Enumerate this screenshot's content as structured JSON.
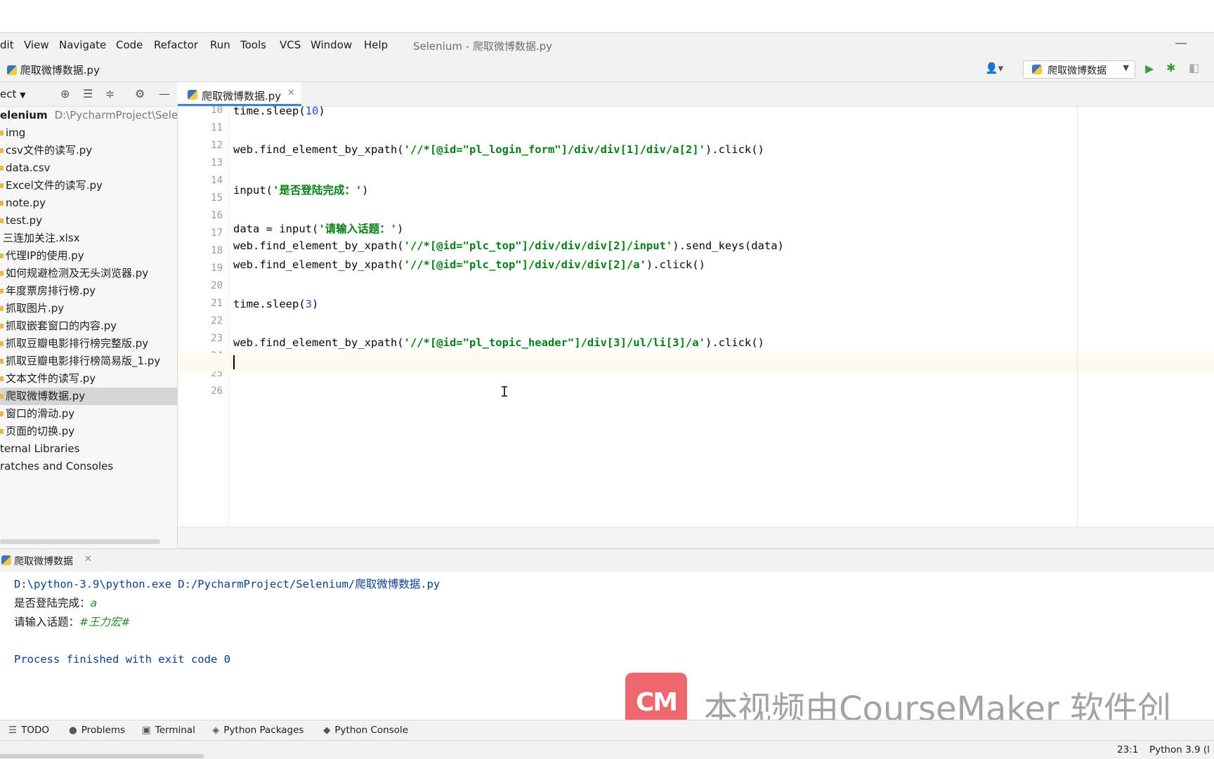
{
  "menubar": {
    "items": [
      "dit",
      "View",
      "Navigate",
      "Code",
      "Refactor",
      "Run",
      "Tools",
      "VCS",
      "Window",
      "Help"
    ],
    "title": "Selenium - 爬取微博数据.py",
    "minimize": "—"
  },
  "navbar": {
    "breadcrumb": "爬取微博数据.py",
    "run_config": "爬取微博数据",
    "icons": [
      "user-icon",
      "run-icon",
      "debug-icon",
      "coverage-icon"
    ]
  },
  "project": {
    "header_label": "ect",
    "root_name": "elenium",
    "root_path": "D:\\PycharmProject\\Seleniu",
    "items": [
      "img",
      "csv文件的读写.py",
      "data.csv",
      "Excel文件的读写.py",
      "note.py",
      "test.py",
      "三连加关注.xlsx",
      "代理IP的使用.py",
      "如何规避检测及无头浏览器.py",
      "年度票房排行榜.py",
      "抓取图片.py",
      "抓取嵌套窗口的内容.py",
      "抓取豆瓣电影排行榜完整版.py",
      "抓取豆瓣电影排行榜简易版_1.py",
      "文本文件的读写.py",
      "爬取微博数据.py",
      "窗口的滑动.py",
      "页面的切换.py"
    ],
    "selected": "爬取微博数据.py",
    "external": "ternal Libraries",
    "scratches": "ratches and Consoles"
  },
  "editor": {
    "tab_label": "爬取微博数据.py",
    "line_numbers": [
      "10",
      "11",
      "12",
      "13",
      "14",
      "15",
      "16",
      "17",
      "18",
      "19",
      "20",
      "21",
      "22",
      "23",
      "24",
      "25",
      "26"
    ],
    "current_line": "23",
    "lines": {
      "l10_a": "time.sleep(",
      "l10_n": "10",
      "l10_b": ")",
      "l12_a": "web.find_element_by_xpath(",
      "l12_s": "'//*[@id=\"pl_login_form\"]/div/div[1]/div/a[2]'",
      "l12_b": ").click()",
      "l14_a": "input(",
      "l14_s": "'是否登陆完成：'",
      "l14_b": ")",
      "l16_a": "data = input(",
      "l16_s": "'请输入话题：'",
      "l16_b": ")",
      "l17_a": "web.find_element_by_xpath(",
      "l17_s": "'//*[@id=\"plc_top\"]/div/div/div[2]/input'",
      "l17_b": ").send_keys(data)",
      "l18_a": "web.find_element_by_xpath(",
      "l18_s": "'//*[@id=\"plc_top\"]/div/div/div[2]/a'",
      "l18_b": ").click()",
      "l20_a": "time.sleep(",
      "l20_n": "3",
      "l20_b": ")",
      "l22_a": "web.find_element_by_xpath(",
      "l22_s": "'//*[@id=\"pl_topic_header\"]/div[3]/ul/li[3]/a'",
      "l22_b": ").click()"
    },
    "cursor_glyph": "I"
  },
  "run_panel": {
    "tab_label": "爬取微博数据",
    "command": "D:\\python-3.9\\python.exe D:/PycharmProject/Selenium/爬取微博数据.py",
    "prompt1": "是否登陆完成：",
    "input1": "a",
    "prompt2": "请输入话题：",
    "input2": "#王力宏#",
    "finished": "Process finished with exit code 0"
  },
  "watermark": {
    "logo": "CM",
    "text": "本视频由CourseMaker 软件创"
  },
  "toolwindows": [
    "TODO",
    "Problems",
    "Terminal",
    "Python Packages",
    "Python Console"
  ],
  "statusbar": {
    "position": "23:1",
    "interpreter": "Python 3.9 (l"
  },
  "colors": {
    "string": "#067d17",
    "number": "#1750eb",
    "console_path": "#0b3f8c",
    "user_input": "#2a8a2a",
    "tab_accent": "#4083c9",
    "watermark_logo": "#e8434a"
  }
}
